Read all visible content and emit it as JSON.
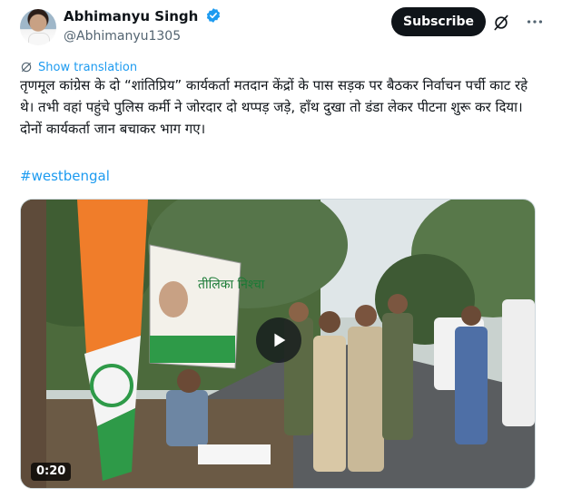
{
  "author": {
    "display_name": "Abhimanyu Singh",
    "handle": "@Abhimanyu1305"
  },
  "actions": {
    "subscribe_label": "Subscribe"
  },
  "translation": {
    "label": "Show translation"
  },
  "tweet": {
    "text": "तृणमूल कांग्रेस के दो “शांतिप्रिय” कार्यकर्ता मतदान केंद्रों के पास सड़क पर बैठकर निर्वाचन पर्ची काट रहे थे। तभी वहां पहुंचे पुलिस कर्मी ने जोरदार दो थप्पड़ जड़े, हाँथ दुखा तो डंडा लेकर पीटना शुरू कर दिया। दोनों कार्यकर्ता जान बचाकर भाग गए।",
    "hashtag": "#westbengal"
  },
  "media": {
    "duration": "0:20",
    "banner_text": "तीलिका निश्चा"
  },
  "colors": {
    "accent": "#1d9bf0",
    "text": "#0f1419",
    "muted": "#536471",
    "button": "#0f1419"
  },
  "icons": [
    "verified-badge-icon",
    "grok-icon",
    "more-icon",
    "translate-icon",
    "play-icon"
  ]
}
